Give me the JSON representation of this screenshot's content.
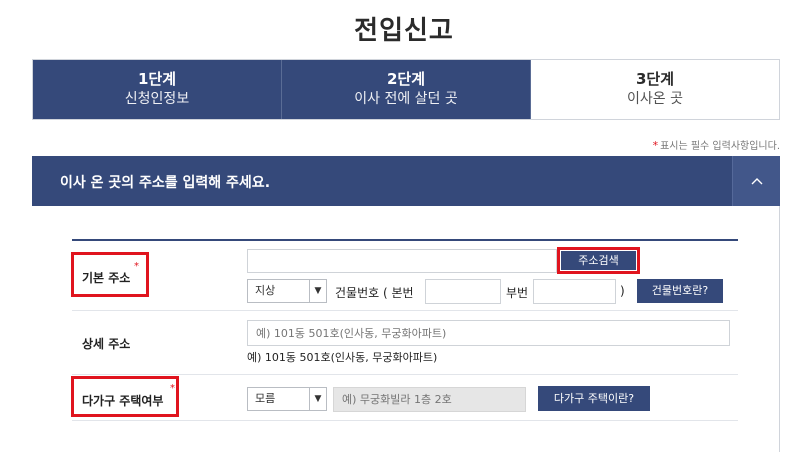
{
  "page_title": "전입신고",
  "steps": [
    {
      "num": "1단계",
      "label": "신청인정보"
    },
    {
      "num": "2단계",
      "label": "이사 전에 살던 곳"
    },
    {
      "num": "3단계",
      "label": "이사온 곳"
    }
  ],
  "required_note": {
    "star": "*",
    "text": "표시는 필수 입력사항입니다."
  },
  "section": {
    "title": "이사 온 곳의 주소를 입력해 주세요.",
    "toggle": "^"
  },
  "basic_address": {
    "label": "기본 주소",
    "required": "*",
    "address_value": "",
    "search_button": "주소검색",
    "type_select": "지상",
    "building_label": "건물번호 ( 본번",
    "main_number": "",
    "sub_label": "부번",
    "sub_number": "",
    "close_paren": ")",
    "building_help_button": "건물번호란?"
  },
  "detail_address": {
    "label": "상세 주소",
    "placeholder": "예) 101동 501호(인사동, 무궁화아파트)",
    "example": "예) 101동 501호(인사동, 무궁화아파트)"
  },
  "multi_household": {
    "label": "다가구 주택여부",
    "required": "*",
    "select_value": "모름",
    "placeholder": "예) 무궁화빌라 1층 2호",
    "help_button": "다가구 주택이란?"
  }
}
